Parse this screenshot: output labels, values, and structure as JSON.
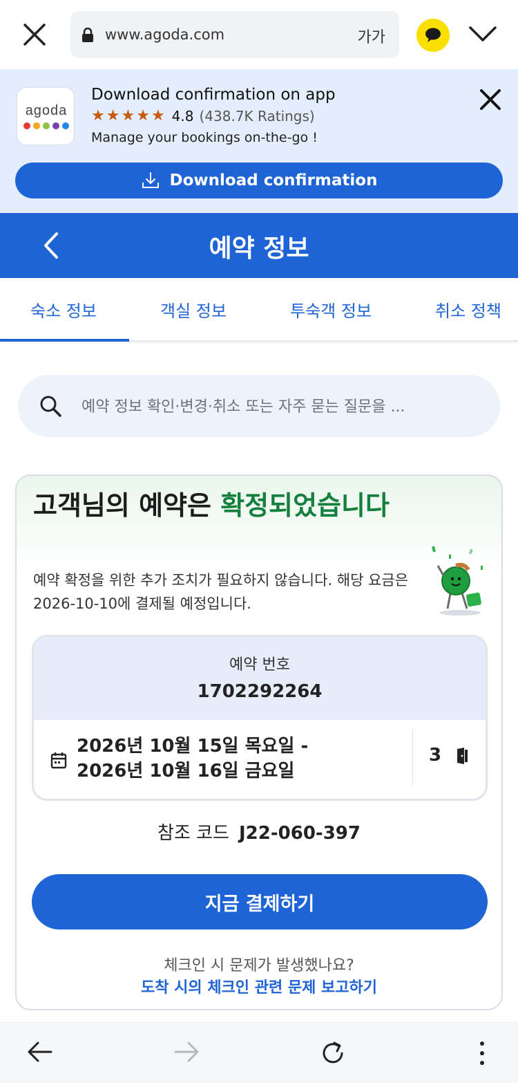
{
  "browser": {
    "url": "www.agoda.com",
    "font_size_label": "가가"
  },
  "app_banner": {
    "logo_text": "agoda",
    "title": "Download confirmation on app",
    "rating": "4.8",
    "rating_count": "(438.7K Ratings)",
    "stars": 5,
    "subtitle": "Manage your bookings on-the-go !",
    "download_label": "Download confirmation"
  },
  "header": {
    "title": "예약 정보"
  },
  "tabs": [
    {
      "label": "숙소 정보",
      "active": true
    },
    {
      "label": "객실 정보",
      "active": false
    },
    {
      "label": "투숙객 정보",
      "active": false
    },
    {
      "label": "취소 정책",
      "active": false
    }
  ],
  "search": {
    "placeholder": "예약 정보 확인·변경·취소 또는 자주 묻는 질문을 ..."
  },
  "booking": {
    "title_prefix": "고객님의 예약은 ",
    "title_highlight": "확정되었습니다",
    "description": "예약 확정을 위한 추가 조치가 필요하지 않습니다. 해당 요금은 2026-10-10에 결제될 예정입니다.",
    "reservation_label": "예약 번호",
    "reservation_number": "1702292264",
    "date_from": "2026년 10월 15일 목요일 -",
    "date_to": "2026년 10월 16일 금요일",
    "rooms": "3",
    "reference_label": "참조 코드",
    "reference_code": "J22-060-397",
    "pay_label": "지금 결제하기",
    "issue_question": "체크인 시 문제가 발생했나요?",
    "issue_link": "도착 시의 체크인 관련 문제 보고하기"
  },
  "colors": {
    "brand_blue": "#1f64d6",
    "confirm_green": "#15803d",
    "banner_bg": "#e3edfc",
    "star": "#c85a10"
  }
}
